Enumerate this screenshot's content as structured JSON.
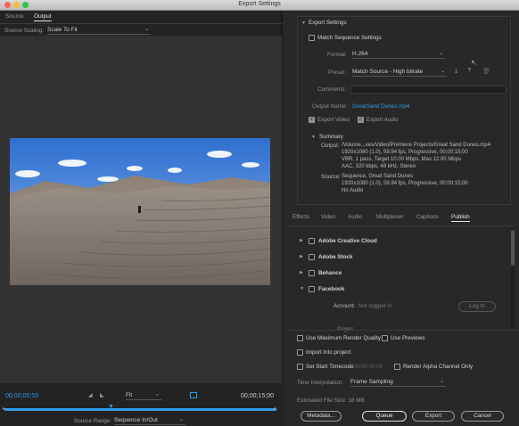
{
  "window": {
    "title": "Export Settings"
  },
  "left": {
    "tabs": [
      {
        "label": "Source"
      },
      {
        "label": "Output"
      }
    ],
    "source_scaling": {
      "label": "Source Scaling:",
      "value": "Scale To Fit"
    },
    "timeline": {
      "current_tc": "00;00;05;53",
      "end_tc": "00;00;15;00",
      "zoom": "Fit",
      "source_range_label": "Source Range:",
      "source_range_value": "Sequence In/Out"
    }
  },
  "export_settings": {
    "header": "Export Settings",
    "match_sequence": "Match Sequence Settings",
    "format_label": "Format:",
    "format_value": "H.264",
    "preset_label": "Preset:",
    "preset_value": "Match Source - High bitrate",
    "comments_label": "Comments:",
    "comments_value": "",
    "output_name_label": "Output Name:",
    "output_name_value": "GreatSand Dunes.mp4",
    "export_video": "Export Video",
    "export_audio": "Export Audio",
    "summary": {
      "header": "Summary",
      "output_label": "Output:",
      "output_lines": [
        "/Volume...ves/Video/Premiere Projects/Great Sand Dunes.mp4",
        "1920x1080 (1.0), 59.94 fps, Progressive, 00;00;15;00",
        "VBR, 1 pass, Target 10.00 Mbps, Max 12.00 Mbps",
        "AAC, 320 kbps, 48 kHz, Stereo"
      ],
      "source_label": "Source:",
      "source_lines": [
        "Sequence, Great Sand Dunes",
        "1920x1080 (1.0), 59.94 fps, Progressive, 00;00;15;00",
        "No Audio"
      ]
    }
  },
  "settings_tabs": [
    {
      "label": "Effects"
    },
    {
      "label": "Video"
    },
    {
      "label": "Audio"
    },
    {
      "label": "Multiplexer"
    },
    {
      "label": "Captions"
    },
    {
      "label": "Publish"
    }
  ],
  "publish": {
    "items": [
      {
        "label": "Adobe Creative Cloud"
      },
      {
        "label": "Adobe Stock"
      },
      {
        "label": "Behance"
      },
      {
        "label": "Facebook"
      }
    ],
    "facebook": {
      "account_label": "Account:",
      "account_value": "Not logged in",
      "login_label": "Log In",
      "pages_label": "Pages:"
    }
  },
  "bottom": {
    "max_render_quality": "Use Maximum Render Quality",
    "use_previews": "Use Previews",
    "import_into_project": "Import into project",
    "set_start_timecode": "Set Start Timecode",
    "start_timecode": "00;00;00;00",
    "render_alpha": "Render Alpha Channel Only",
    "time_interp_label": "Time Interpolation:",
    "time_interp_value": "Frame Sampling",
    "file_size": "Estimated File Size: 18 MB",
    "buttons": {
      "metadata": "Metadata...",
      "queue": "Queue",
      "export": "Export",
      "cancel": "Cancel"
    }
  },
  "colors": {
    "accent": "#2f9be6",
    "panel": "#282828",
    "preview_bg": "#323232"
  }
}
